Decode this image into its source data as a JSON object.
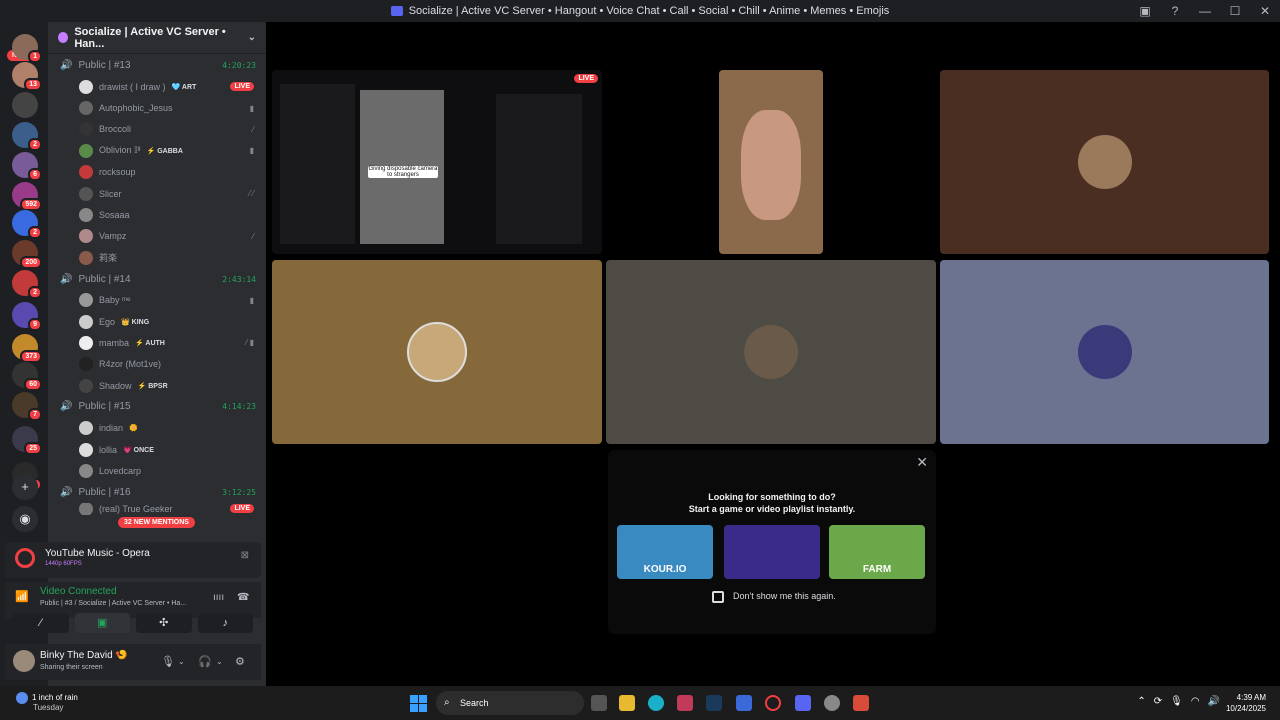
{
  "window": {
    "title": "Socialize | Active VC Server • Hangout • Voice Chat • Call • Social • Chill • Anime • Memes • Emojis",
    "controls": [
      "—",
      "☐",
      "✕"
    ]
  },
  "colors": {
    "accent": "#5865f2",
    "live": "#f23f43",
    "online": "#23a55a",
    "sidebar": "#2b2d31",
    "rail": "#1e1f22"
  },
  "rail": {
    "new_label": "NEW",
    "badges": [
      "1",
      "13",
      "2",
      "6",
      "592",
      "2",
      "200",
      "2",
      "9",
      "373",
      "60",
      "7",
      "25",
      "2"
    ]
  },
  "server": {
    "name": "Socialize | Active VC Server • Han..."
  },
  "channels": [
    {
      "name": "Public | #13",
      "timer": "4:20:23",
      "users": [
        {
          "name": "drawist ( I draw )",
          "tag": "🩵 ART",
          "live": "LIVE"
        },
        {
          "name": "Autophobic_Jesus",
          "icon": "▮"
        },
        {
          "name": "Broccoli",
          "icon": "⁄"
        },
        {
          "name": "Oblivion 𝕀ᴵᴵ",
          "tag": "⚡ GABBA",
          "icon": "▮"
        },
        {
          "name": "rocksoup"
        },
        {
          "name": "Slicer",
          "icon": "⁄ ⁄"
        },
        {
          "name": "Sosaaa"
        },
        {
          "name": "Vampz",
          "icon": "⁄"
        },
        {
          "name": "莉楽"
        }
      ]
    },
    {
      "name": "Public | #14",
      "timer": "2:43:14",
      "users": [
        {
          "name": "Baby ᵐᵉ",
          "icon": "▮"
        },
        {
          "name": "Ego",
          "tag": "👑 KING"
        },
        {
          "name": "mamba",
          "tag": "⚡ AUTH",
          "icon": "⁄ ▮"
        },
        {
          "name": "R4zor (Mot1ve)"
        },
        {
          "name": "Shadow",
          "tag": "⚡ BPSR"
        }
      ]
    },
    {
      "name": "Public | #15",
      "timer": "4:14:23",
      "users": [
        {
          "name": "indian",
          "tag": "🌼"
        },
        {
          "name": "lollia",
          "tag": "💗 ONCE"
        },
        {
          "name": "Lovedcarp"
        }
      ]
    },
    {
      "name": "Public | #16",
      "timer": "3:12:25",
      "users": [
        {
          "name": "(real) True Geeker",
          "live": "LIVE"
        }
      ]
    }
  ],
  "mentions_pill": "32 NEW MENTIONS",
  "activity": {
    "title": "YouTube Music - Opera",
    "sub": "1440p 60FPS"
  },
  "voice": {
    "status": "Video Connected",
    "channel": "Public | #3 / Socialize | Active VC Server • Ha..."
  },
  "user": {
    "name": "Binky The David 🍤",
    "status": "Sharing their screen"
  },
  "stage": {
    "live_label": "LIVE",
    "stream_caption": "Giving disposable camera to strangers"
  },
  "popup": {
    "line1": "Looking for something to do?",
    "line2": "Start a game or video playlist instantly.",
    "games": [
      "KOUR.IO",
      "",
      "FARM"
    ],
    "checkbox_label": "Don't show me this again.",
    "close": "✕"
  },
  "taskbar": {
    "weather_title": "1 inch of rain",
    "weather_day": "Tuesday",
    "search": "Search",
    "time": "4:39 AM",
    "date": "10/24/2025"
  }
}
